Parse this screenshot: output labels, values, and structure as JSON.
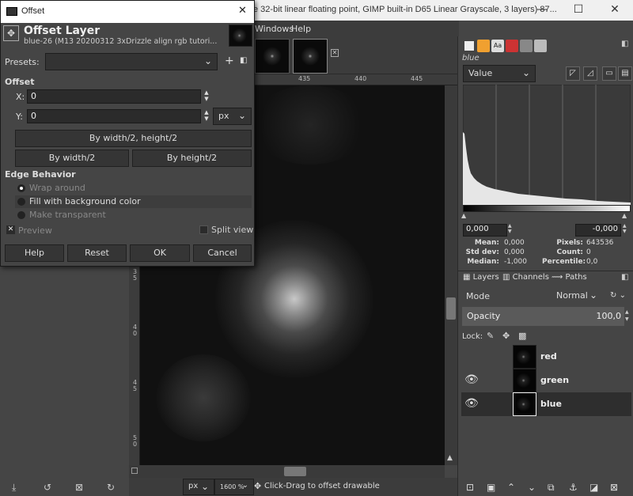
{
  "window": {
    "title": "e 32-bit linear floating point, GIMP built-in D65 Linear Grayscale, 3 layers) 87...",
    "minimize": "—",
    "maximize": "☐",
    "close": "✕"
  },
  "menubar": {
    "windows": "Windows",
    "help": "Help"
  },
  "ruler": {
    "t1": "435",
    "t2": "440",
    "t3": "445",
    "l1": "3\n5",
    "l2": "4\n0",
    "l3": "4\n5",
    "l4": "5\n0"
  },
  "statusbar": {
    "unit": "px",
    "zoom": "1600 %",
    "message": "Click-Drag to offset drawable"
  },
  "histogram": {
    "channel_label": "blue",
    "channel_select": "Value",
    "range_min": "0,000",
    "range_max": "-0,000",
    "stats": {
      "mean_label": "Mean:",
      "mean": "0,000",
      "stddev_label": "Std dev:",
      "stddev": "0,000",
      "median_label": "Median:",
      "median": "-1,000",
      "pixels_label": "Pixels:",
      "pixels": "643536",
      "count_label": "Count:",
      "count": "0",
      "percentile_label": "Percentile:",
      "percentile": "0,0"
    }
  },
  "layers_panel": {
    "tabs": [
      "Layers",
      "Channels",
      "Paths"
    ],
    "mode_label": "Mode",
    "mode_value": "Normal",
    "opacity_label": "Opacity",
    "opacity_value": "100,0",
    "lock_label": "Lock:",
    "layers": [
      {
        "name": "red",
        "visible": false,
        "selected": false
      },
      {
        "name": "green",
        "visible": true,
        "selected": false
      },
      {
        "name": "blue",
        "visible": true,
        "selected": true
      }
    ]
  },
  "dialog": {
    "window_title": "Offset",
    "heading": "Offset Layer",
    "subheading": "blue-26 (M13 20200312 3xDrizzle align rgb tutori...",
    "presets_label": "Presets:",
    "presets_value": "",
    "offset_section": "Offset",
    "x_label": "X:",
    "x_value": "0",
    "y_label": "Y:",
    "y_value": "0",
    "unit": "px",
    "btn_half_both": "By width/2, height/2",
    "btn_half_w": "By width/2",
    "btn_half_h": "By height/2",
    "edge_section": "Edge Behavior",
    "edge_options": [
      "Wrap around",
      "Fill with background color",
      "Make transparent"
    ],
    "edge_selected": 0,
    "preview_label": "Preview",
    "split_label": "Split view",
    "btn_help": "Help",
    "btn_reset": "Reset",
    "btn_ok": "OK",
    "btn_cancel": "Cancel"
  },
  "colors": {
    "accent_select": "#2e2e2e",
    "dialog_bg": "#454545"
  }
}
